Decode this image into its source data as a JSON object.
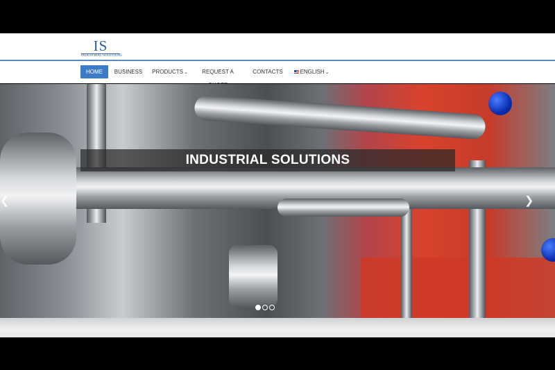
{
  "logo": {
    "mark": "IS",
    "subtitle": "INDUSTRIAL SOLUTIONS"
  },
  "nav": {
    "items": [
      {
        "label": "HOME",
        "active": true
      },
      {
        "label": "BUSINESS"
      },
      {
        "label": "PRODUCTS",
        "has_dropdown": true
      },
      {
        "label": "REQUEST A QUOTE"
      },
      {
        "label": "CONTACTS"
      },
      {
        "label": "ENGLISH",
        "has_dropdown": true,
        "icon": "us-flag-icon"
      }
    ]
  },
  "hero": {
    "caption": "INDUSTRIAL SOLUTIONS",
    "prev_icon": "chevron-left-icon",
    "next_icon": "chevron-right-icon",
    "slides_count": 3,
    "active_slide": 1
  },
  "colors": {
    "accent": "#3c7bc7",
    "header_border": "#5a88c4",
    "logo": "#2e5e9e"
  }
}
